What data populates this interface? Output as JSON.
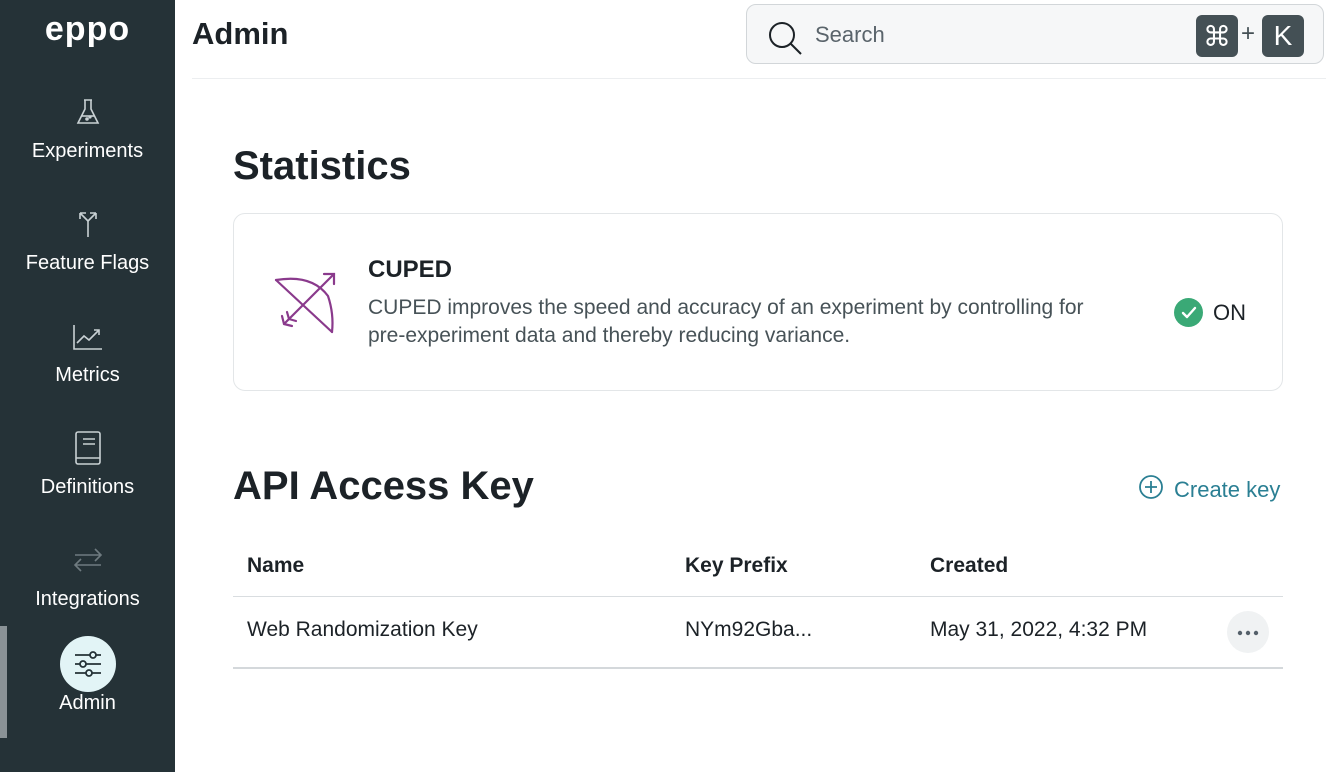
{
  "sidebar": {
    "logo": "eppo",
    "items": [
      {
        "label": "Experiments",
        "icon": "flask-icon"
      },
      {
        "label": "Feature Flags",
        "icon": "fork-arrows-icon"
      },
      {
        "label": "Metrics",
        "icon": "trend-chart-icon"
      },
      {
        "label": "Definitions",
        "icon": "book-icon"
      },
      {
        "label": "Integrations",
        "icon": "swap-arrows-icon"
      },
      {
        "label": "Admin",
        "icon": "sliders-icon",
        "active": true
      }
    ]
  },
  "header": {
    "title": "Admin",
    "search": {
      "placeholder": "Search",
      "shortcut_key1": "⌘",
      "shortcut_plus": "+",
      "shortcut_key2": "K"
    }
  },
  "statistics": {
    "title": "Statistics",
    "card": {
      "icon": "bow-arrow-icon",
      "title": "CUPED",
      "description_line1": "CUPED improves the speed and accuracy of an experiment by controlling for",
      "description_line2": "pre-experiment data and thereby reducing variance.",
      "status": "ON"
    }
  },
  "api": {
    "title": "API Access Key",
    "create_label": "Create key",
    "columns": [
      "Name",
      "Key Prefix",
      "Created"
    ],
    "rows": [
      {
        "name": "Web Randomization Key",
        "key_prefix": "NYm92Gba...",
        "created": "May 31, 2022, 4:32 PM"
      }
    ]
  },
  "colors": {
    "sidebar_bg": "#253237",
    "accent": "#2a7f93",
    "cuped_icon": "#8a3a8c",
    "status_on": "#3aa976"
  }
}
